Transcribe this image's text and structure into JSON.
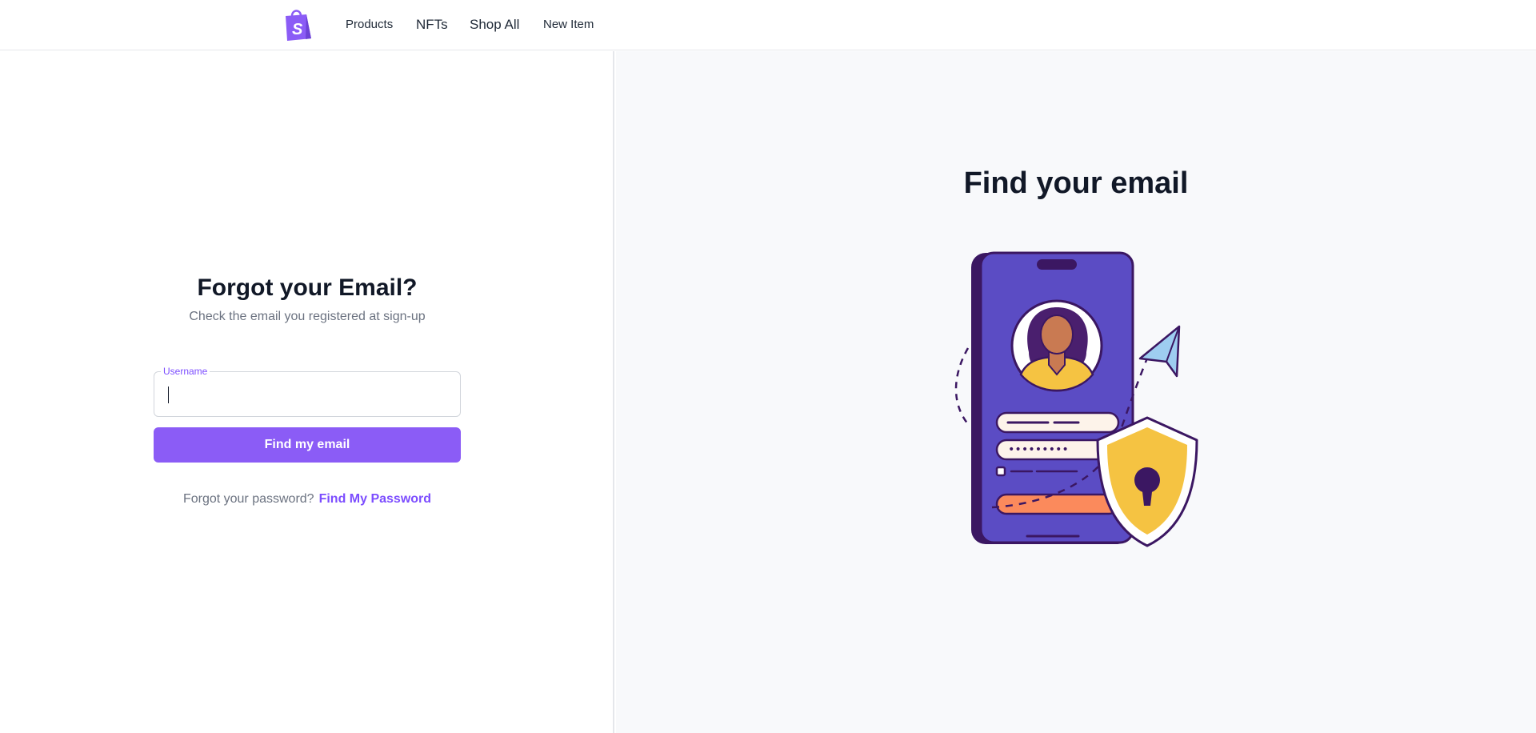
{
  "nav": {
    "logo_icon": "shopping-bag-icon",
    "links": [
      "Products",
      "NFTs",
      "Shop All",
      "New Item"
    ]
  },
  "form": {
    "title": "Forgot your Email?",
    "subtitle": "Check the email you registered at sign-up",
    "username_label": "Username",
    "username_value": "",
    "submit_label": "Find my email",
    "forgot_text": "Forgot your password?",
    "forgot_link": "Find My Password"
  },
  "illustration": {
    "title": "Find your email",
    "icon": "phone-login-security-illustration"
  },
  "colors": {
    "accent": "#8b5cf6",
    "phone": "#5b4cc4",
    "shield": "#f5c342"
  }
}
